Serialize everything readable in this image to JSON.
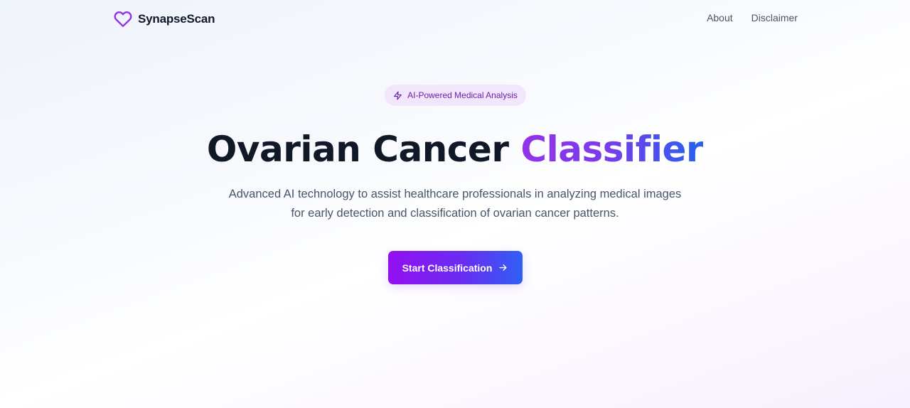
{
  "brand": {
    "name": "SynapseScan",
    "logo_icon": "heart-icon",
    "accent_color": "#9333ea"
  },
  "nav": {
    "links": [
      "About",
      "Disclaimer"
    ]
  },
  "hero": {
    "badge": {
      "icon": "lightning-icon",
      "label": "AI-Powered Medical Analysis"
    },
    "title_main": "Ovarian Cancer",
    "title_accent": "Classifier",
    "subtitle_line1": "Advanced AI technology to assist healthcare professionals in analyzing medical images",
    "subtitle_line2": "for early detection and classification of ovarian cancer patterns.",
    "cta": {
      "label": "Start Classification",
      "icon": "arrow-right-icon"
    },
    "colors": {
      "gradient_start": "#9333ea",
      "gradient_end": "#2563eb"
    }
  }
}
